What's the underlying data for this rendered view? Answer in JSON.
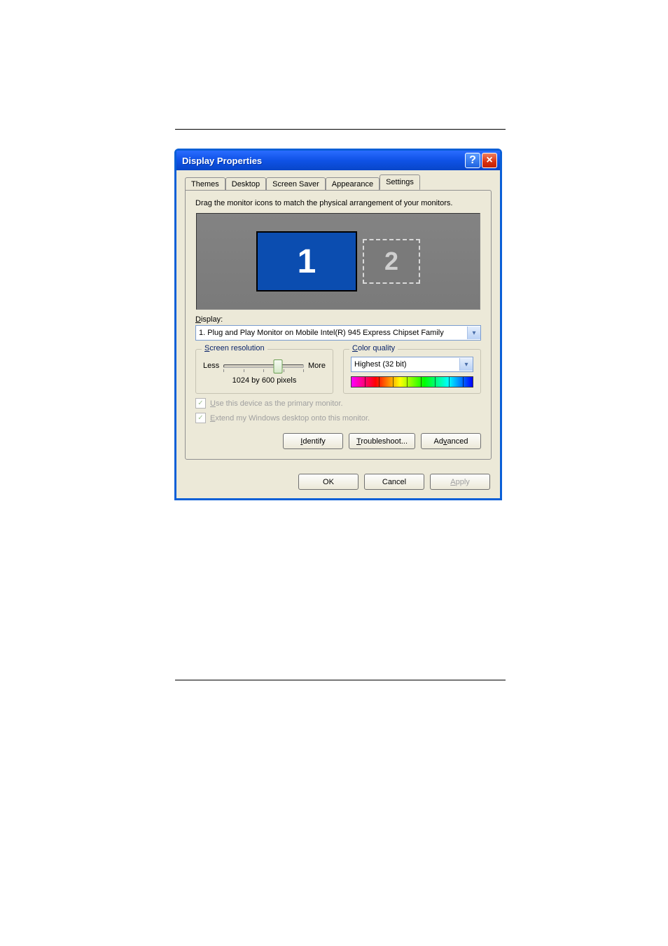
{
  "window": {
    "title": "Display Properties",
    "help_symbol": "?",
    "close_symbol": "×"
  },
  "tabs": [
    {
      "label": "Themes",
      "active": false
    },
    {
      "label": "Desktop",
      "active": false
    },
    {
      "label": "Screen Saver",
      "active": false
    },
    {
      "label": "Appearance",
      "active": false
    },
    {
      "label": "Settings",
      "active": true
    }
  ],
  "instruction": "Drag the monitor icons to match the physical arrangement of your monitors.",
  "monitors": {
    "primary": "1",
    "secondary": "2"
  },
  "display": {
    "label_pre": "D",
    "label_rest": "isplay:",
    "selected": "1. Plug and Play Monitor on Mobile Intel(R) 945 Express Chipset Family"
  },
  "resolution": {
    "legend_pre": "S",
    "legend_rest": "creen resolution",
    "less": "Less",
    "more": "More",
    "value": "1024 by 600 pixels"
  },
  "colorquality": {
    "legend_pre": "C",
    "legend_rest": "olor quality",
    "selected": "Highest (32 bit)"
  },
  "checks": {
    "primary_pre": "U",
    "primary_rest": "se this device as the primary monitor.",
    "extend_pre": "E",
    "extend_rest": "xtend my Windows desktop onto this monitor."
  },
  "panelButtons": {
    "identify_pre": "I",
    "identify_rest": "dentify",
    "trouble_pre": "T",
    "trouble_rest": "roubleshoot...",
    "advanced_pre": "Ad",
    "advanced_u": "v",
    "advanced_post": "anced"
  },
  "footer": {
    "ok": "OK",
    "cancel": "Cancel",
    "apply_pre": "A",
    "apply_rest": "pply"
  }
}
